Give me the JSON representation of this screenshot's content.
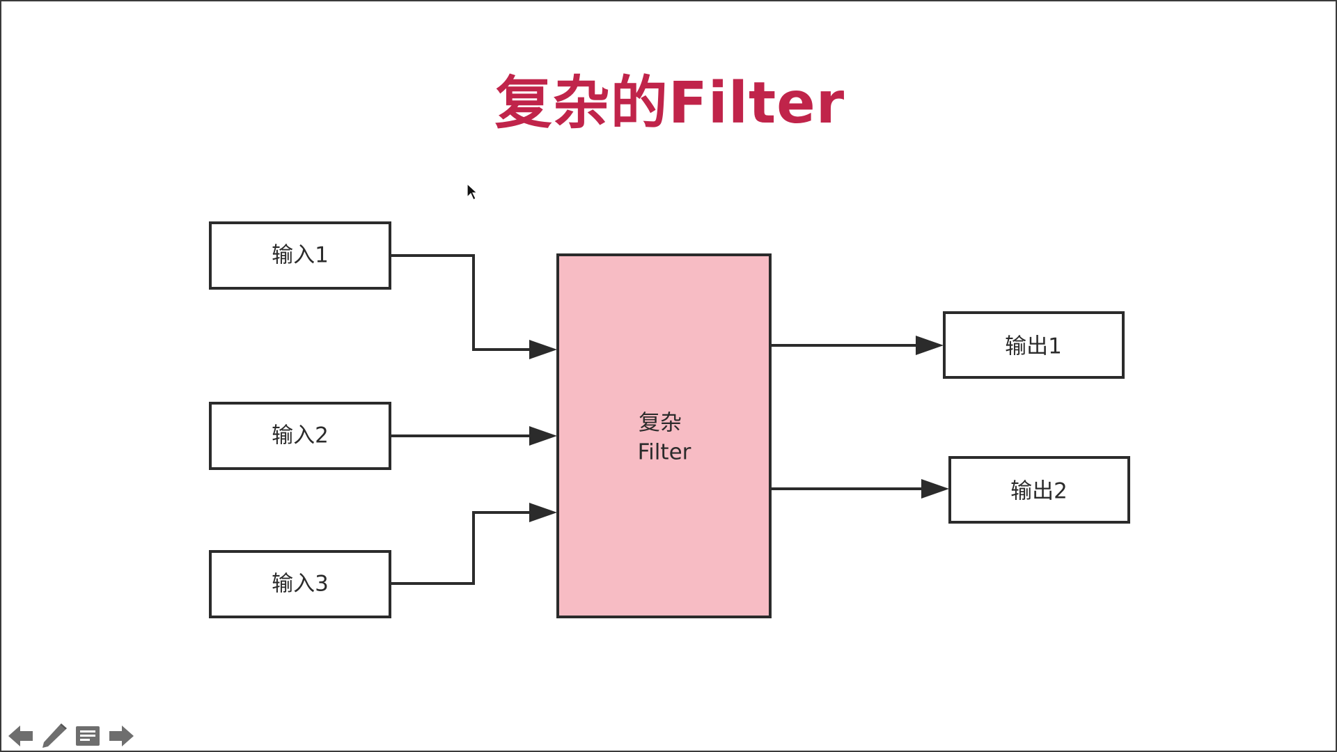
{
  "slide": {
    "title": "复杂的Filter"
  },
  "diagram": {
    "inputs": [
      {
        "id": "in1",
        "label": "输入1"
      },
      {
        "id": "in2",
        "label": "输入2"
      },
      {
        "id": "in3",
        "label": "输入3"
      }
    ],
    "filter": {
      "id": "filter",
      "label_line1": "复杂",
      "label_line2": "Filter"
    },
    "outputs": [
      {
        "id": "out1",
        "label": "输出1"
      },
      {
        "id": "out2",
        "label": "输出2"
      }
    ],
    "edges": [
      {
        "from": "in1",
        "to": "filter"
      },
      {
        "from": "in2",
        "to": "filter"
      },
      {
        "from": "in3",
        "to": "filter"
      },
      {
        "from": "filter",
        "to": "out1"
      },
      {
        "from": "filter",
        "to": "out2"
      }
    ]
  },
  "colors": {
    "title": "#c0244a",
    "filter_fill": "#f7bcc4",
    "stroke": "#2b2b2b"
  },
  "toolbar": {
    "icons": [
      "arrow-left-icon",
      "pencil-icon",
      "menu-icon",
      "arrow-right-icon"
    ]
  }
}
